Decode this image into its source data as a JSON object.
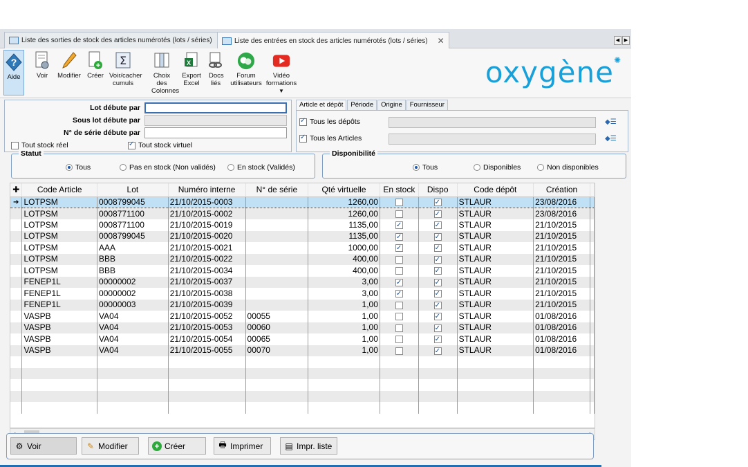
{
  "tabs": [
    {
      "label": "Liste des sorties de stock des articles numérotés (lots / séries)",
      "active": false
    },
    {
      "label": "Liste des entrées en stock des articles numérotés (lots / séries)",
      "active": true
    }
  ],
  "toolbar": {
    "help": "Aide",
    "voir": "Voir",
    "modifier": "Modifier",
    "creer": "Créer",
    "cumuls": "Voir/cacher cumuls",
    "colonnes": "Choix des Colonnes",
    "excel": "Export Excel",
    "docs": "Docs liés",
    "forum": "Forum utilisateurs",
    "video": "Vidéo formations"
  },
  "logo": "oxygène",
  "filters": {
    "lot_label": "Lot débute par",
    "lot_value": "",
    "souslot_label": "Sous lot débute par",
    "serie_label": "N° de série débute par",
    "serie_value": "",
    "tout_reel": "Tout stock réel",
    "tout_virtuel": "Tout stock virtuel"
  },
  "subtabs": [
    "Article et dépôt",
    "Période",
    "Origine",
    "Fournisseur"
  ],
  "article": {
    "tous_depots": "Tous les dépôts",
    "tous_articles": "Tous les Articles"
  },
  "statut": {
    "title": "Statut",
    "options": [
      "Tous",
      "Pas en stock (Non validés)",
      "En stock (Validés)"
    ],
    "selected": "Tous"
  },
  "dispo": {
    "title": "Disponibilité",
    "options": [
      "Tous",
      "Disponibles",
      "Non disponibles"
    ],
    "selected": "Tous"
  },
  "grid": {
    "columns": [
      "Code Article",
      "Lot",
      "Numéro interne",
      "N° de série",
      "Qté virtuelle",
      "En stock",
      "Dispo",
      "Code dépôt",
      "Création"
    ],
    "rows": [
      {
        "code": "LOTPSM",
        "lot": "0008799045",
        "num": "21/10/2015-0003",
        "serie": "",
        "qte": "1260,00",
        "stock": false,
        "dispo": true,
        "depot": "STLAUR",
        "creation": "23/08/2016"
      },
      {
        "code": "LOTPSM",
        "lot": "0008771100",
        "num": "21/10/2015-0002",
        "serie": "",
        "qte": "1260,00",
        "stock": false,
        "dispo": true,
        "depot": "STLAUR",
        "creation": "23/08/2016"
      },
      {
        "code": "LOTPSM",
        "lot": "0008771100",
        "num": "21/10/2015-0019",
        "serie": "",
        "qte": "1135,00",
        "stock": true,
        "dispo": true,
        "depot": "STLAUR",
        "creation": "21/10/2015"
      },
      {
        "code": "LOTPSM",
        "lot": "0008799045",
        "num": "21/10/2015-0020",
        "serie": "",
        "qte": "1135,00",
        "stock": true,
        "dispo": true,
        "depot": "STLAUR",
        "creation": "21/10/2015"
      },
      {
        "code": "LOTPSM",
        "lot": "AAA",
        "num": "21/10/2015-0021",
        "serie": "",
        "qte": "1000,00",
        "stock": true,
        "dispo": true,
        "depot": "STLAUR",
        "creation": "21/10/2015"
      },
      {
        "code": "LOTPSM",
        "lot": "BBB",
        "num": "21/10/2015-0022",
        "serie": "",
        "qte": "400,00",
        "stock": false,
        "dispo": true,
        "depot": "STLAUR",
        "creation": "21/10/2015"
      },
      {
        "code": "LOTPSM",
        "lot": "BBB",
        "num": "21/10/2015-0034",
        "serie": "",
        "qte": "400,00",
        "stock": false,
        "dispo": true,
        "depot": "STLAUR",
        "creation": "21/10/2015"
      },
      {
        "code": "FENEP1L",
        "lot": "00000002",
        "num": "21/10/2015-0037",
        "serie": "",
        "qte": "3,00",
        "stock": true,
        "dispo": true,
        "depot": "STLAUR",
        "creation": "21/10/2015"
      },
      {
        "code": "FENEP1L",
        "lot": "00000002",
        "num": "21/10/2015-0038",
        "serie": "",
        "qte": "3,00",
        "stock": true,
        "dispo": true,
        "depot": "STLAUR",
        "creation": "21/10/2015"
      },
      {
        "code": "FENEP1L",
        "lot": "00000003",
        "num": "21/10/2015-0039",
        "serie": "",
        "qte": "1,00",
        "stock": false,
        "dispo": true,
        "depot": "STLAUR",
        "creation": "21/10/2015"
      },
      {
        "code": "VASPB",
        "lot": "VA04",
        "num": "21/10/2015-0052",
        "serie": "00055",
        "qte": "1,00",
        "stock": false,
        "dispo": true,
        "depot": "STLAUR",
        "creation": "01/08/2016"
      },
      {
        "code": "VASPB",
        "lot": "VA04",
        "num": "21/10/2015-0053",
        "serie": "00060",
        "qte": "1,00",
        "stock": false,
        "dispo": true,
        "depot": "STLAUR",
        "creation": "01/08/2016"
      },
      {
        "code": "VASPB",
        "lot": "VA04",
        "num": "21/10/2015-0054",
        "serie": "00065",
        "qte": "1,00",
        "stock": false,
        "dispo": true,
        "depot": "STLAUR",
        "creation": "01/08/2016"
      },
      {
        "code": "VASPB",
        "lot": "VA04",
        "num": "21/10/2015-0055",
        "serie": "00070",
        "qte": "1,00",
        "stock": false,
        "dispo": true,
        "depot": "STLAUR",
        "creation": "01/08/2016"
      }
    ],
    "empty_rows": 5
  },
  "bottom": {
    "voir": "Voir",
    "modifier": "Modifier",
    "creer": "Créer",
    "imprimer": "Imprimer",
    "impr_liste": "Impr. liste"
  }
}
